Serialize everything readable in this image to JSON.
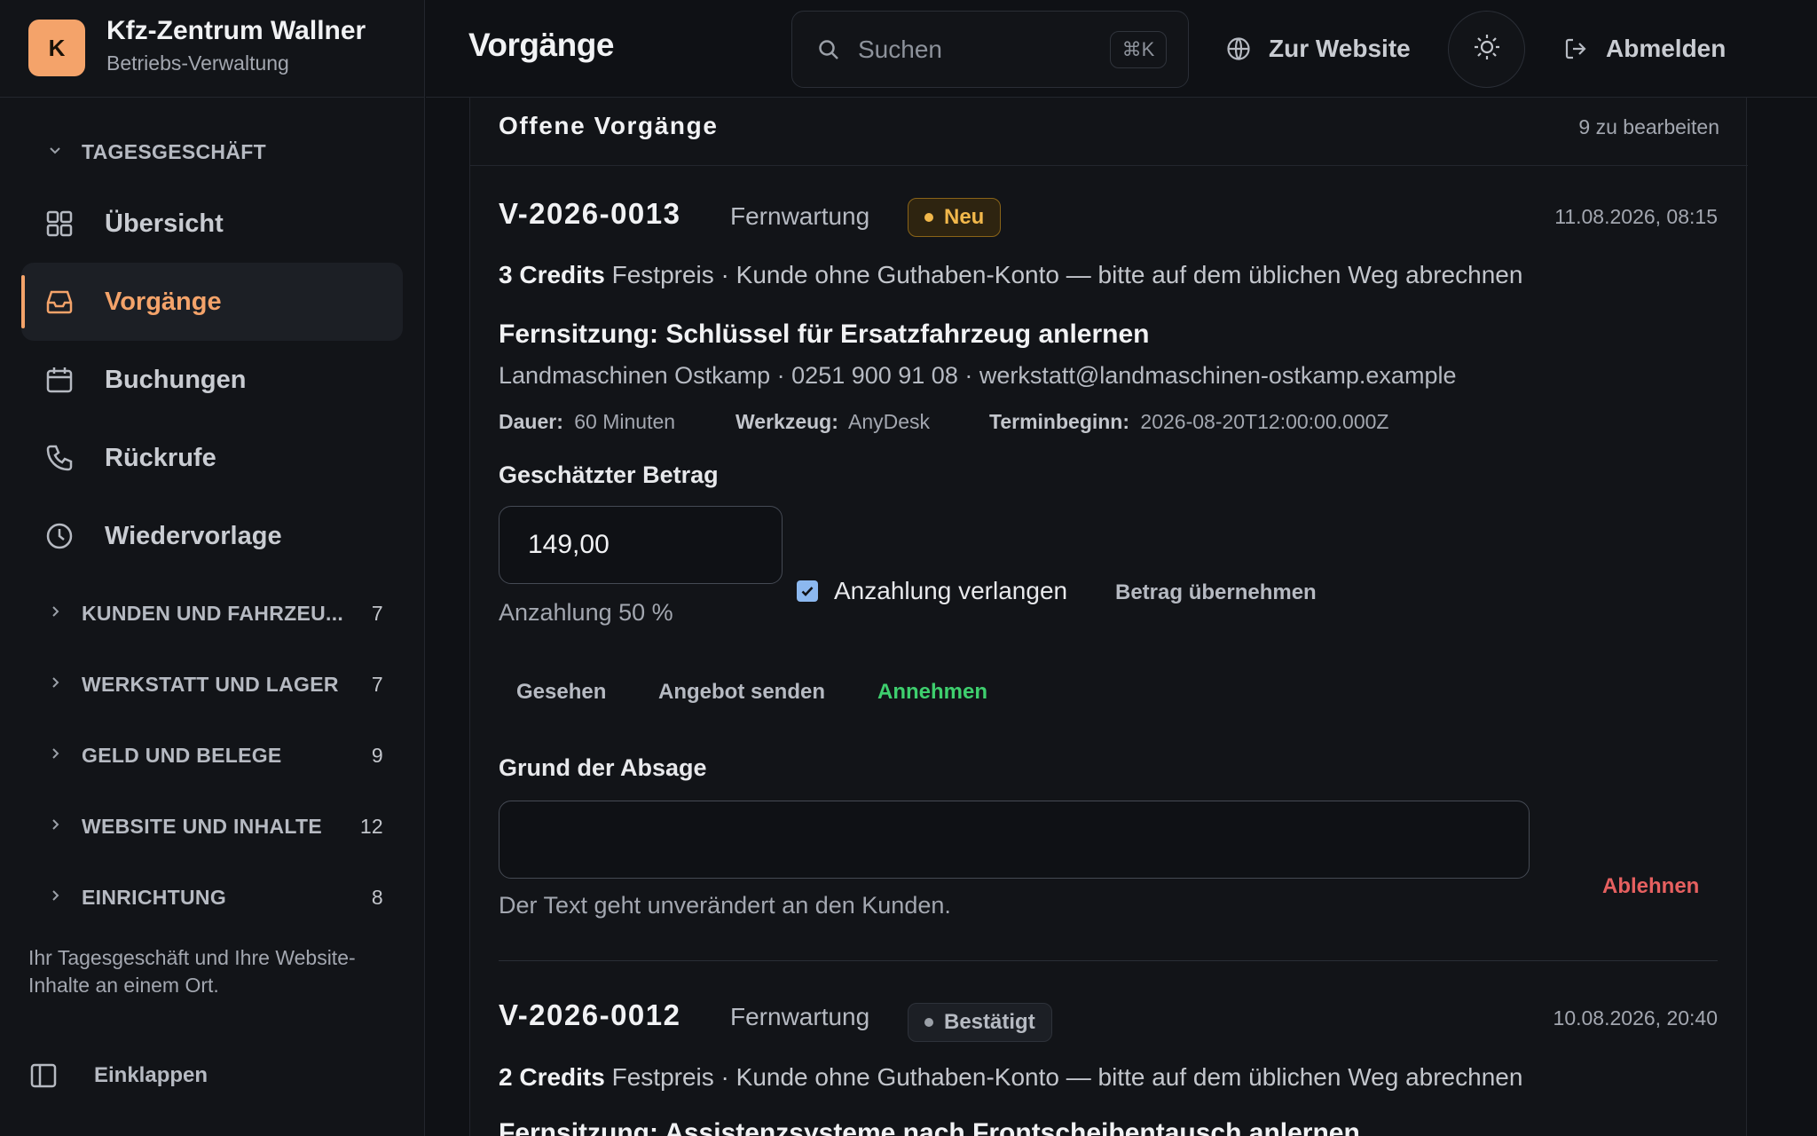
{
  "brand": {
    "initial": "K",
    "name": "Kfz-Zentrum Wallner",
    "subtitle": "Betriebs-Verwaltung"
  },
  "sidebar": {
    "section_today": "TAGESGESCHÄFT",
    "items": [
      {
        "label": "Übersicht",
        "icon": "grid-icon"
      },
      {
        "label": "Vorgänge",
        "icon": "inbox-icon",
        "active": true
      },
      {
        "label": "Buchungen",
        "icon": "calendar-icon"
      },
      {
        "label": "Rückrufe",
        "icon": "phone-icon"
      },
      {
        "label": "Wiedervorlage",
        "icon": "clock-icon"
      }
    ],
    "groups": [
      {
        "label": "KUNDEN UND FAHRZEU...",
        "count": "7"
      },
      {
        "label": "WERKSTATT UND LAGER",
        "count": "7"
      },
      {
        "label": "GELD UND BELEGE",
        "count": "9"
      },
      {
        "label": "WEBSITE UND INHALTE",
        "count": "12"
      },
      {
        "label": "EINRICHTUNG",
        "count": "8"
      }
    ],
    "note": "Ihr Tagesgeschäft und Ihre Website-Inhalte an einem Ort.",
    "collapse_label": "Einklappen"
  },
  "topbar": {
    "title": "Vorgänge",
    "search_placeholder": "Suchen",
    "search_shortcut": "⌘K",
    "website_label": "Zur Website",
    "logout_label": "Abmelden"
  },
  "card": {
    "title": "Offene Vorgänge",
    "count_text": "9 zu bearbeiten",
    "first": {
      "id": "V-2026-0013",
      "type": "Fernwartung",
      "status": "Neu",
      "date": "11.08.2026, 08:15",
      "credits_bold": "3 Credits",
      "credits_rest": "Festpreis · Kunde ohne Guthaben-Konto — bitte auf dem üblichen Weg abrechnen",
      "title": "Fernsitzung: Schlüssel für Ersatzfahrzeug anlernen",
      "contact": "Landmaschinen Ostkamp · 0251 900 91 08 · werkstatt@landmaschinen-ostkamp.example",
      "duration_label": "Dauer:",
      "duration_value": "60 Minuten",
      "tool_label": "Werkzeug:",
      "tool_value": "AnyDesk",
      "start_label": "Terminbeginn:",
      "start_value": "2026-08-20T12:00:00.000Z",
      "amount_label": "Geschätzter Betrag",
      "amount_value": "149,00",
      "deposit_hint": "Anzahlung 50 %",
      "deposit_checkbox_label": "Anzahlung verlangen",
      "deposit_checked": true,
      "apply_amount_label": "Betrag übernehmen",
      "seen_label": "Gesehen",
      "send_offer_label": "Angebot senden",
      "accept_label": "Annehmen",
      "reason_label": "Grund der Absage",
      "reason_value": "",
      "reason_hint": "Der Text geht unverändert an den Kunden.",
      "reject_label": "Ablehnen"
    },
    "second": {
      "id": "V-2026-0012",
      "type": "Fernwartung",
      "status": "Bestätigt",
      "date": "10.08.2026, 20:40",
      "credits_bold": "2 Credits",
      "credits_rest": "Festpreis · Kunde ohne Guthaben-Konto — bitte auf dem üblichen Weg abrechnen",
      "title": "Fernsitzung: Assistenzsysteme nach Frontscheibentausch anlernen"
    }
  },
  "colors": {
    "accent": "#f4a36a",
    "accept": "#3ecf6e",
    "reject": "#e66060",
    "badge_new": "#f2b84b"
  }
}
